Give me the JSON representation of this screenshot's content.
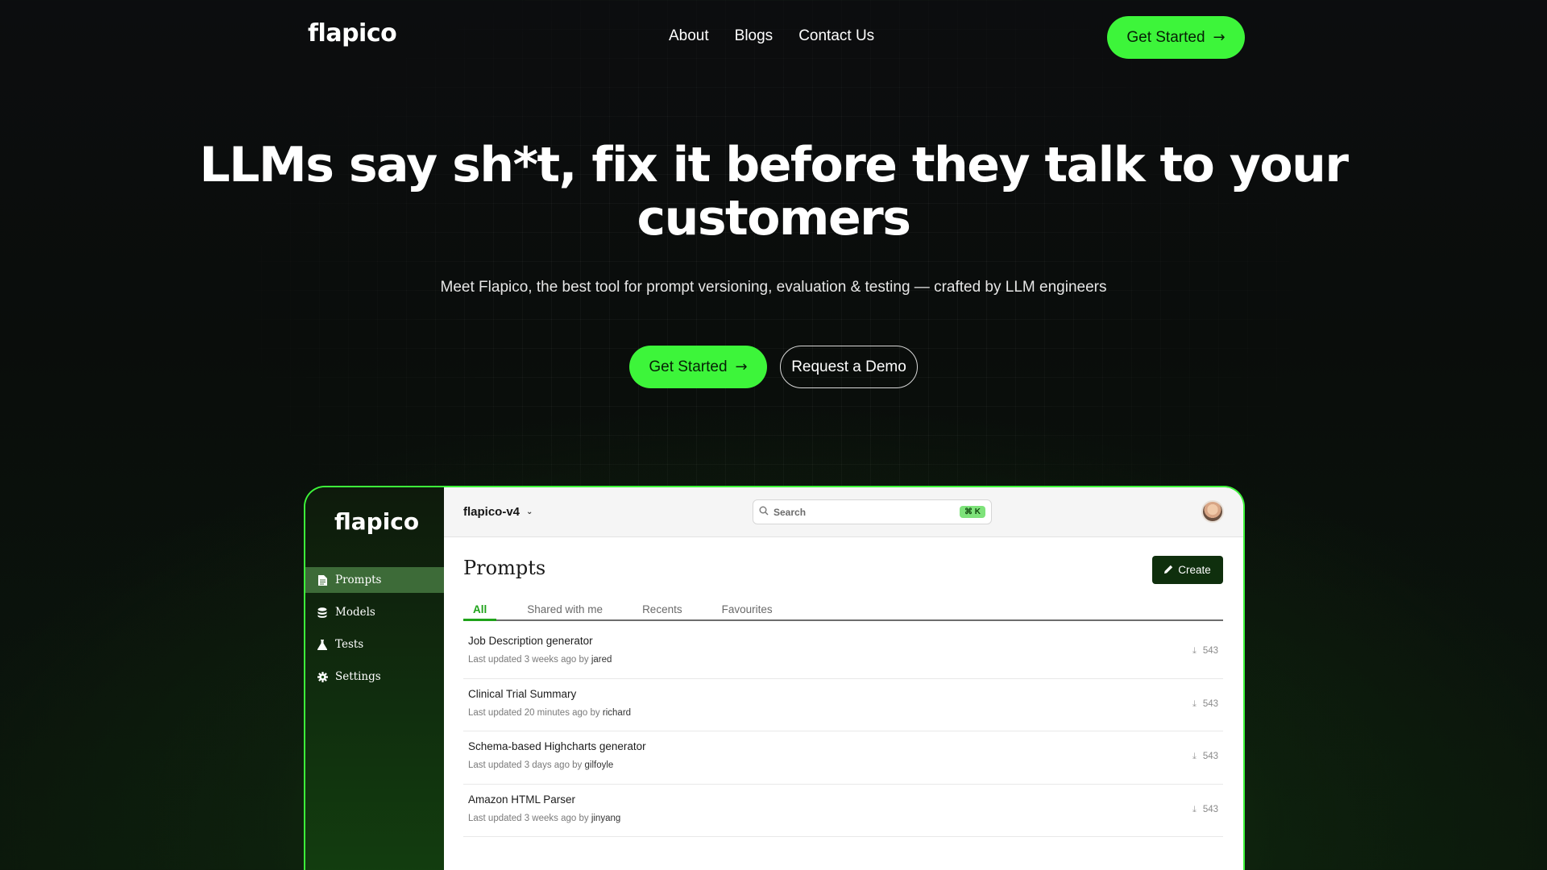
{
  "nav": {
    "logo": "flapico",
    "links": [
      "About",
      "Blogs",
      "Contact Us"
    ],
    "cta": "Get Started"
  },
  "hero": {
    "title_line1": "LLMs say sh*t, fix it before they talk to your",
    "title_line2": "customers",
    "subtitle": "Meet Flapico, the best tool for prompt versioning, evaluation & testing — crafted by LLM engineers",
    "primary_cta": "Get Started",
    "secondary_cta": "Request a Demo"
  },
  "app": {
    "logo": "flapico",
    "sidebar": [
      {
        "label": "Prompts",
        "icon": "document-icon",
        "active": true
      },
      {
        "label": "Models",
        "icon": "database-icon",
        "active": false
      },
      {
        "label": "Tests",
        "icon": "flask-icon",
        "active": false
      },
      {
        "label": "Settings",
        "icon": "gear-icon",
        "active": false
      }
    ],
    "project": "flapico-v4",
    "search_placeholder": "Search",
    "search_shortcut": "⌘ K",
    "page_title": "Prompts",
    "create_label": "Create",
    "tabs": [
      {
        "label": "All",
        "active": true
      },
      {
        "label": "Shared with me",
        "active": false
      },
      {
        "label": "Recents",
        "active": false
      },
      {
        "label": "Favourites",
        "active": false
      }
    ],
    "prompts": [
      {
        "title": "Job Description generator",
        "updated": "Last updated 3 weeks ago by",
        "user": "jared",
        "count": "543"
      },
      {
        "title": "Clinical Trial Summary",
        "updated": "Last updated 20 minutes ago by",
        "user": "richard",
        "count": "543"
      },
      {
        "title": "Schema-based Highcharts generator",
        "updated": "Last updated 3 days ago by",
        "user": "gilfoyle",
        "count": "543"
      },
      {
        "title": "Amazon HTML Parser",
        "updated": "Last updated 3 weeks ago by",
        "user": "jinyang",
        "count": "543"
      }
    ]
  },
  "colors": {
    "accent_green": "#3df53a",
    "dark_green": "#0f2f0d",
    "background": "#0c0d0f"
  }
}
